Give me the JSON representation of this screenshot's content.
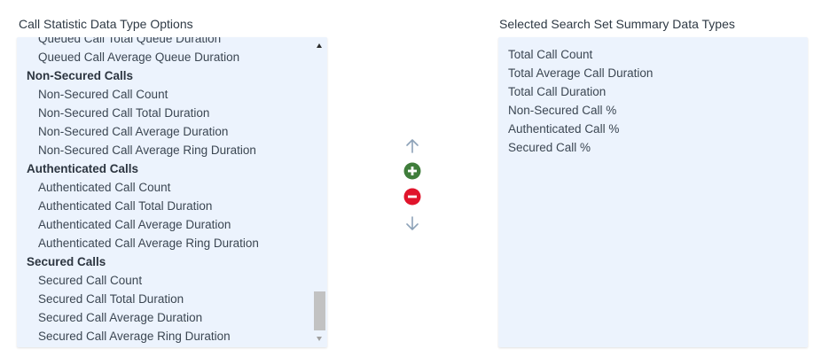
{
  "left_panel": {
    "title": "Call Statistic Data Type Options",
    "rows": [
      {
        "type": "item",
        "label": "Queued Call Total Queue Duration"
      },
      {
        "type": "item",
        "label": "Queued Call Average Queue Duration"
      },
      {
        "type": "group",
        "label": "Non-Secured Calls"
      },
      {
        "type": "item",
        "label": "Non-Secured Call Count"
      },
      {
        "type": "item",
        "label": "Non-Secured Call Total Duration"
      },
      {
        "type": "item",
        "label": "Non-Secured Call Average Duration"
      },
      {
        "type": "item",
        "label": "Non-Secured Call Average Ring Duration"
      },
      {
        "type": "group",
        "label": "Authenticated Calls"
      },
      {
        "type": "item",
        "label": "Authenticated Call Count"
      },
      {
        "type": "item",
        "label": "Authenticated Call Total Duration"
      },
      {
        "type": "item",
        "label": "Authenticated Call Average Duration"
      },
      {
        "type": "item",
        "label": "Authenticated Call Average Ring Duration"
      },
      {
        "type": "group",
        "label": "Secured Calls"
      },
      {
        "type": "item",
        "label": "Secured Call Count"
      },
      {
        "type": "item",
        "label": "Secured Call Total Duration"
      },
      {
        "type": "item",
        "label": "Secured Call Average Duration"
      },
      {
        "type": "item",
        "label": "Secured Call Average Ring Duration"
      }
    ],
    "scroll_position": 1.0
  },
  "right_panel": {
    "title": "Selected Search Set Summary Data Types",
    "items": [
      "Total Call Count",
      "Total Average Call Duration",
      "Total Call Duration",
      "Non-Secured Call %",
      "Authenticated Call %",
      "Secured Call %"
    ]
  },
  "controls": {
    "move_up": {
      "icon": "arrow-up-icon",
      "color": "#8da2b8"
    },
    "add": {
      "icon": "plus-circle-icon",
      "color": "#3f7d3b"
    },
    "remove": {
      "icon": "minus-circle-icon",
      "color": "#e0142b"
    },
    "move_down": {
      "icon": "arrow-down-icon",
      "color": "#8da2b8"
    }
  },
  "colors": {
    "list_background": "#ecf3fd",
    "text": "#3b4652"
  }
}
